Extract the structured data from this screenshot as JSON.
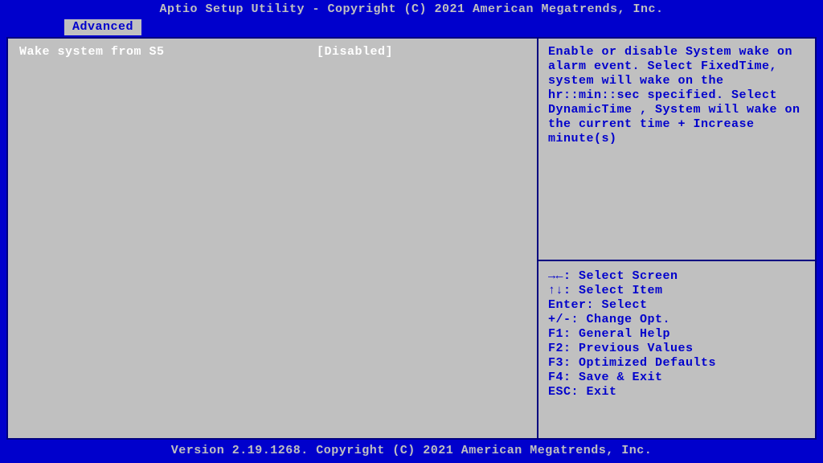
{
  "header": {
    "title": "Aptio Setup Utility - Copyright (C) 2021 American Megatrends, Inc."
  },
  "tab": {
    "label": "Advanced"
  },
  "setting": {
    "label": "Wake system from S5",
    "value": "[Disabled]"
  },
  "help": {
    "text": "Enable or disable System wake on alarm event. Select FixedTime, system will wake on the hr::min::sec specified. Select DynamicTime , System will wake on the current time + Increase minute(s)"
  },
  "keys": {
    "line1": "→←: Select Screen",
    "line2": "↑↓: Select Item",
    "line3": "Enter: Select",
    "line4": "+/-: Change Opt.",
    "line5": "F1: General Help",
    "line6": "F2: Previous Values",
    "line7": "F3: Optimized Defaults",
    "line8": "F4: Save & Exit",
    "line9": "ESC: Exit"
  },
  "footer": {
    "text": "Version 2.19.1268. Copyright (C) 2021 American Megatrends, Inc."
  }
}
